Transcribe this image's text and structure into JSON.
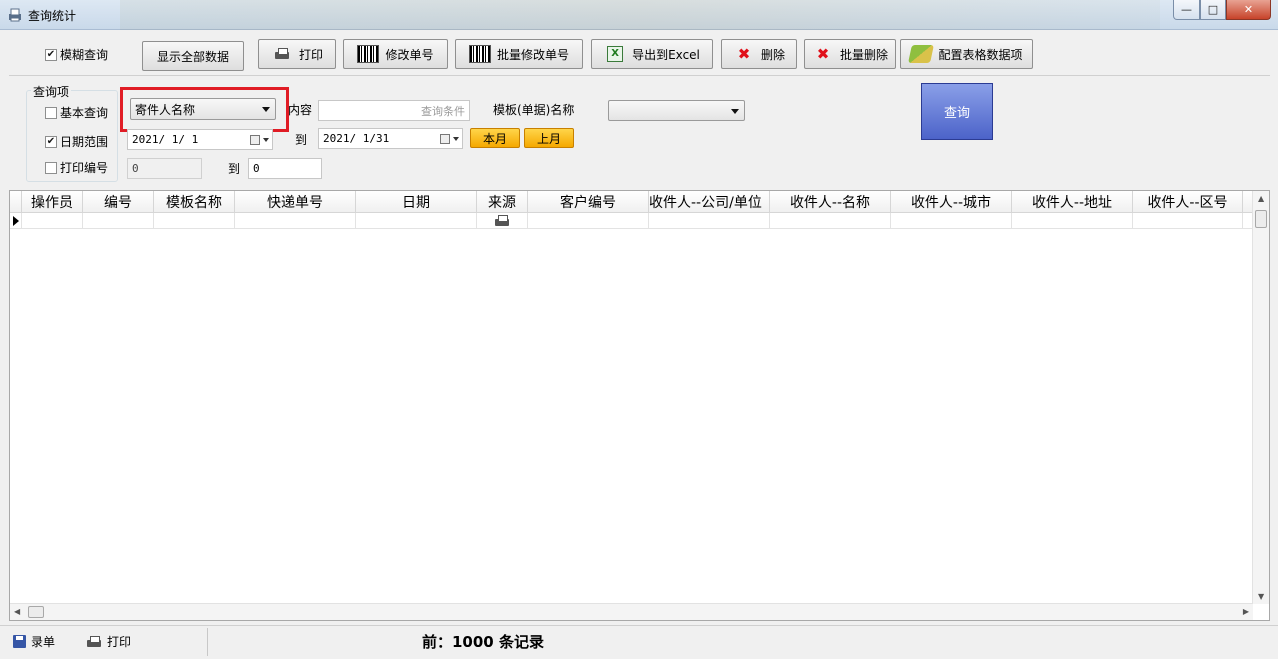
{
  "window": {
    "title": "查询统计"
  },
  "toolbar": {
    "fuzzy_label": "模糊查询",
    "fuzzy_checked": true,
    "show_all": "显示全部数据",
    "print": "打印",
    "edit_no": "修改单号",
    "batch_edit_no": "批量修改单号",
    "export_excel": "导出到Excel",
    "delete": "删除",
    "batch_delete": "批量删除",
    "config_columns": "配置表格数据项"
  },
  "query": {
    "group_title": "查询项",
    "basic_label": "基本查询",
    "basic_checked": false,
    "date_label": "日期范围",
    "date_checked": true,
    "print_no_label": "打印编号",
    "print_no_checked": false,
    "field_select": "寄件人名称",
    "content_label": "内容",
    "content_placeholder": "查询条件",
    "template_label": "模板(单据)名称",
    "template_value": "",
    "date_from": "2021/ 1/ 1",
    "to_label": "到",
    "date_to": "2021/ 1/31",
    "this_month": "本月",
    "last_month": "上月",
    "print_from": "0",
    "print_to": "0",
    "query_button": "查询"
  },
  "table": {
    "columns": [
      "操作员",
      "编号",
      "模板名称",
      "快递单号",
      "日期",
      "来源",
      "客户编号",
      "收件人--公司/单位",
      "收件人--名称",
      "收件人--城市",
      "收件人--地址",
      "收件人--区号"
    ]
  },
  "status": {
    "entry": "录单",
    "print": "打印",
    "record_count": "前：1000 条记录"
  },
  "icons": {
    "print": "printer-icon",
    "edit": "barcode-icon",
    "export": "excel-icon",
    "delete": "red-x-icon",
    "config": "settings-pen-icon",
    "save": "floppy-icon"
  }
}
